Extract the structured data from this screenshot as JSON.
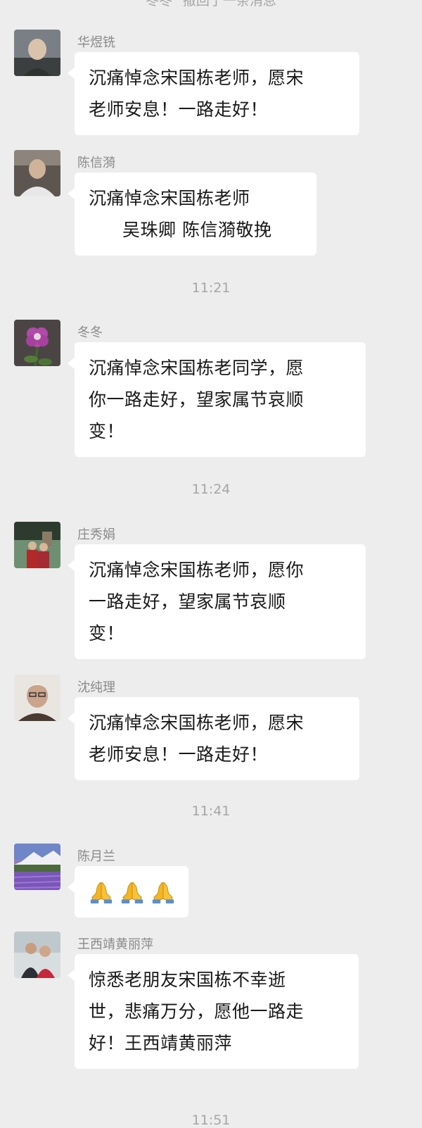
{
  "header": {
    "recall_notice": "冬冬\" 撤回了一条消息"
  },
  "timestamps": [
    "11:21",
    "11:24",
    "11:41",
    "11:51"
  ],
  "messages": [
    {
      "sender": "华煜铣",
      "lines": [
        "沉痛悼念宋国栋老师，愿宋",
        "老师安息！一路走好！"
      ]
    },
    {
      "sender": "陈信漪",
      "lines": [
        "沉痛悼念宋国栋老师",
        "吴珠卿 陈信漪敬挽"
      ]
    },
    {
      "sender": "冬冬",
      "lines": [
        "沉痛悼念宋国栋老同学，愿",
        "你一路走好，望家属节哀顺",
        "变！"
      ]
    },
    {
      "sender": "庄秀娟",
      "lines": [
        "沉痛悼念宋国栋老师，愿你",
        "一路走好，望家属节哀顺",
        "变！"
      ]
    },
    {
      "sender": "沈纯理",
      "lines": [
        "沉痛悼念宋国栋老师，愿宋",
        "老师安息！一路走好！"
      ]
    },
    {
      "sender": "陈月兰",
      "emoji": [
        "folded-hands",
        "folded-hands",
        "folded-hands"
      ]
    },
    {
      "sender": "王西靖黄丽萍",
      "lines": [
        "惊悉老朋友宋国栋不幸逝",
        "世，悲痛万分，愿他一路走",
        "好！王西靖黄丽萍"
      ]
    }
  ]
}
